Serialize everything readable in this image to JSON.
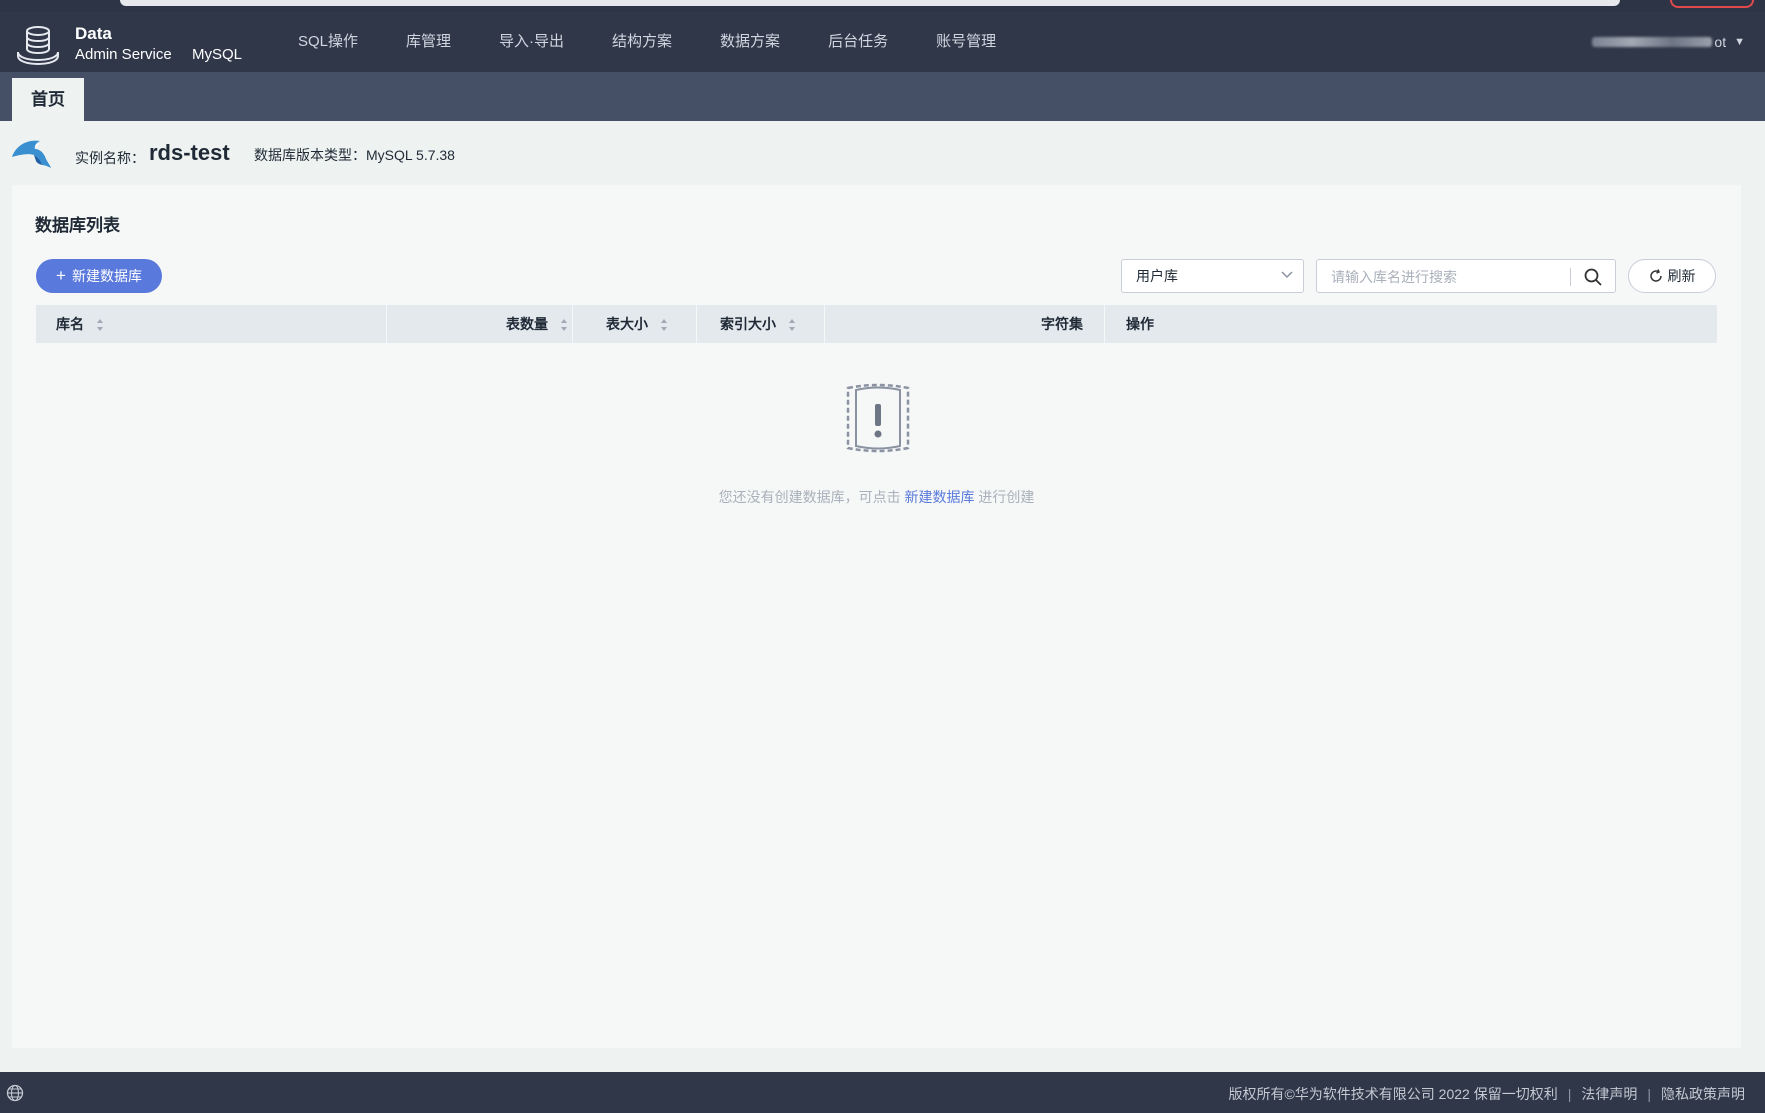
{
  "brand": {
    "line1": "Data",
    "line2": "Admin Service",
    "engine": "MySQL"
  },
  "nav": {
    "items": [
      {
        "label": "SQL操作"
      },
      {
        "label": "库管理"
      },
      {
        "label": "导入·导出"
      },
      {
        "label": "结构方案"
      },
      {
        "label": "数据方案"
      },
      {
        "label": "后台任务"
      },
      {
        "label": "账号管理"
      }
    ],
    "user_suffix": "ot"
  },
  "tabs": {
    "home": "首页"
  },
  "instance": {
    "name_label": "实例名称：",
    "name": "rds-test",
    "version_label": "数据库版本类型：MySQL 5.7.38"
  },
  "panel": {
    "title": "数据库列表",
    "new_button": "新建数据库",
    "select_value": "用户库",
    "search_placeholder": "请输入库名进行搜索",
    "refresh_button": "刷新"
  },
  "table": {
    "columns": [
      "库名",
      "表数量",
      "表大小",
      "索引大小",
      "字符集",
      "操作"
    ]
  },
  "empty": {
    "prefix": "您还没有创建数据库，可点击",
    "link": "新建数据库",
    "suffix": "进行创建"
  },
  "footer": {
    "copyright": "版权所有©华为软件技术有限公司 2022 保留一切权利",
    "legal": "法律声明",
    "privacy": "隐私政策声明"
  },
  "colors": {
    "nav_bg": "#2f3749",
    "tabbar_bg": "#454f66",
    "accent": "#5a79dc",
    "page_bg": "#eef3f1"
  }
}
